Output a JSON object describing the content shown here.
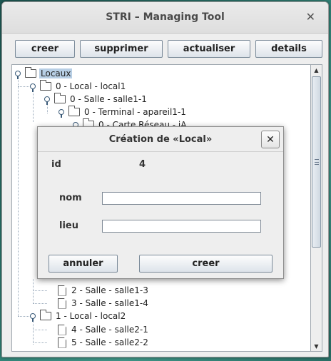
{
  "window": {
    "title": "STRI – Managing Tool",
    "close_icon": "close-icon"
  },
  "toolbar": {
    "create_label": "creer",
    "delete_label": "supprimer",
    "refresh_label": "actualiser",
    "details_label": "details"
  },
  "tree": {
    "root": "Locaux",
    "local1": "0 - Local - local1",
    "salle1_1": "0 - Salle - salle1-1",
    "terminal": "0 - Terminal - apareil1-1",
    "carte": "0 - Carte Réseau - iA",
    "salle1_3": "2 - Salle - salle1-3",
    "salle1_4": "3 - Salle - salle1-4",
    "local2": "1 - Local - local2",
    "salle2_1": "4 - Salle - salle2-1",
    "salle2_2": "5 - Salle - salle2-2"
  },
  "dialog": {
    "title": "Création de «Local»",
    "close_label": "✕",
    "id_label": "id",
    "id_value": "4",
    "nom_label": "nom",
    "nom_value": "",
    "lieu_label": "lieu",
    "lieu_value": "",
    "cancel_label": "annuler",
    "create_label": "creer"
  },
  "colors": {
    "selection": "#b8cfe5",
    "desktop": "#2f7f74"
  }
}
